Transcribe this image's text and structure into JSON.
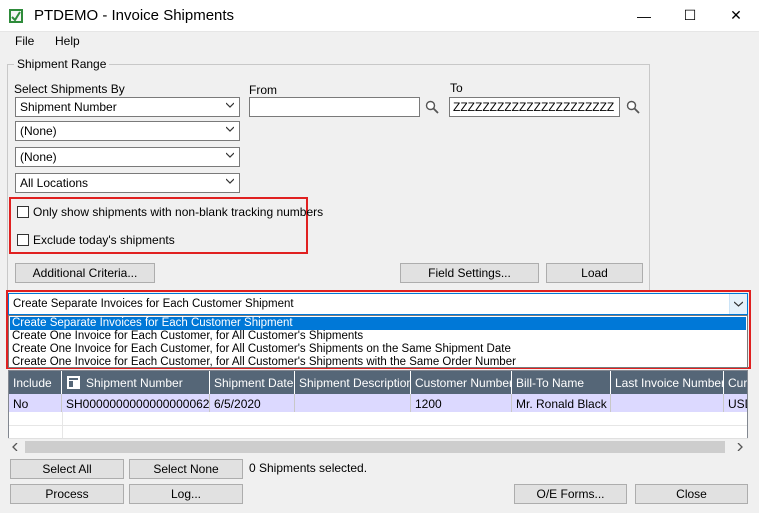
{
  "window": {
    "title": "PTDEMO - Invoice Shipments",
    "minimize": "—",
    "maximize": "☐",
    "close": "✕"
  },
  "menu": {
    "file": "File",
    "help": "Help"
  },
  "shipment_range": {
    "group_label": "Shipment Range",
    "select_by_label": "Select Shipments By",
    "select_by_value": "Shipment Number",
    "filter2_value": "(None)",
    "filter3_value": "(None)",
    "location_value": "All Locations",
    "from_label": "From",
    "from_value": "",
    "to_label": "To",
    "to_value": "ZZZZZZZZZZZZZZZZZZZZZZ",
    "chk_tracking_label": "Only show shipments with non-blank tracking numbers",
    "chk_exclude_today_label": "Exclude today's shipments",
    "additional_criteria_btn": "Additional Criteria...",
    "field_settings_btn": "Field Settings...",
    "load_btn": "Load"
  },
  "invoice_mode": {
    "selected": "Create Separate Invoices for Each Customer Shipment",
    "options": [
      "Create Separate Invoices for Each Customer Shipment",
      "Create One Invoice for Each Customer, for All Customer's Shipments",
      "Create One Invoice for Each Customer, for All Customer's Shipments on the Same Shipment Date",
      "Create One Invoice for Each Customer, for All Customer's Shipments with the Same Order Number"
    ]
  },
  "grid": {
    "columns": [
      "Include",
      "Shipment Number",
      "Shipment Date",
      "Shipment Description",
      "Customer Number",
      "Bill-To Name",
      "Last Invoice Number",
      "Curre"
    ],
    "rows": [
      [
        "No",
        "SH0000000000000000062",
        "6/5/2020",
        "",
        "1200",
        "Mr. Ronald Black",
        "",
        "USD"
      ]
    ]
  },
  "footer": {
    "select_all_btn": "Select All",
    "select_none_btn": "Select None",
    "selected_status": "0 Shipments selected.",
    "process_btn": "Process",
    "log_btn": "Log...",
    "oe_forms_btn": "O/E Forms...",
    "close_btn": "Close"
  }
}
